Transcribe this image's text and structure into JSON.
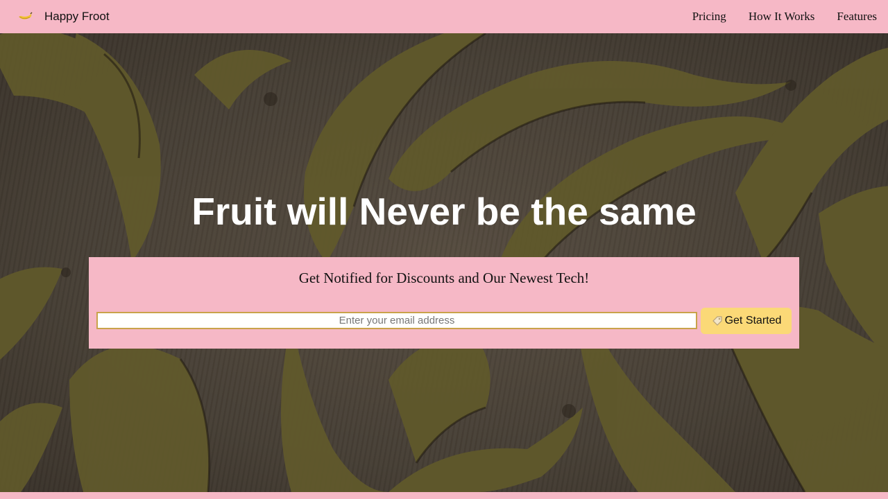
{
  "brand": {
    "name": "Happy Froot",
    "logo_icon": "banana-icon"
  },
  "nav": {
    "links": [
      "Pricing",
      "How It Works",
      "Features"
    ]
  },
  "hero": {
    "background": "bananas-photo",
    "headline": "Fruit will Never be the same"
  },
  "signup": {
    "title": "Get Notified for Discounts and Our Newest Tech!",
    "email_placeholder": "Enter your email address",
    "email_value": "",
    "button_label": "Get Started",
    "button_icon": "tag-icon"
  },
  "colors": {
    "accent_pink": "#f6b8c6",
    "button_yellow": "#fbd977",
    "input_border": "#c9a24a",
    "headline": "#ffffff"
  }
}
